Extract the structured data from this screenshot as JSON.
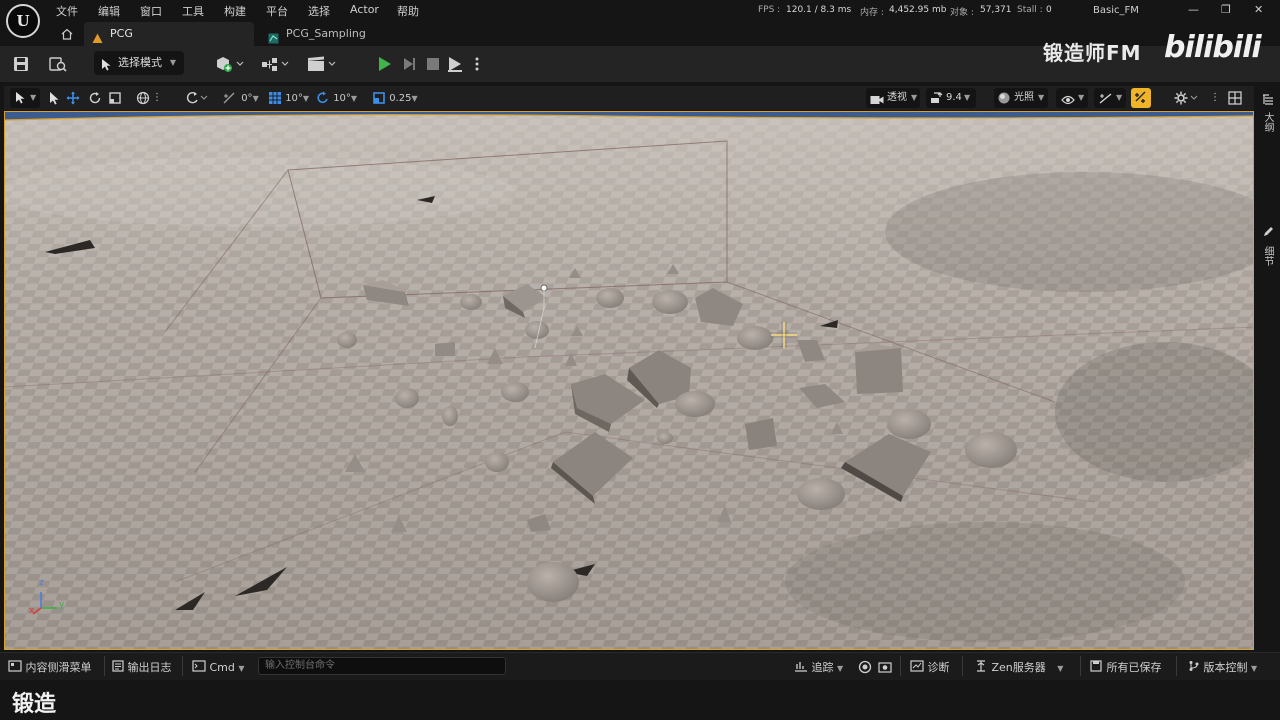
{
  "menu": [
    "文件",
    "编辑",
    "窗口",
    "工具",
    "构建",
    "平台",
    "选择",
    "Actor",
    "帮助"
  ],
  "stats": {
    "fps_label": "FPS :",
    "fps_value": "120.1 / 8.3 ms",
    "memory_label": "内存 :",
    "memory_value": "4,452.95 mb",
    "objects_label": "对象 :",
    "objects_value": "57,371",
    "stall_label": "Stall :",
    "stall_value": "0"
  },
  "project_name": "Basic_FM",
  "logo_text": "U",
  "tabs": [
    {
      "label": "PCG",
      "active": true
    },
    {
      "label": "PCG_Sampling",
      "active": false
    }
  ],
  "toolbar": {
    "mode_label": "选择模式"
  },
  "viewport_toolbar": {
    "rotation_snap": "0°",
    "grid_snap": "10°",
    "rotate_snap": "10°",
    "scale_snap": "0.25",
    "view_mode": "透视",
    "camera_speed": "9.4",
    "lighting_mode": "光照"
  },
  "viewport": {
    "axis_labels": {
      "z": "z",
      "x": "x",
      "y": "y"
    },
    "accent_color": "#d9a22e",
    "ground_color": "#a79e96",
    "shape_color": "#8f8781"
  },
  "side_panel": {
    "outliner": "大纲",
    "details": "细节"
  },
  "statusbar": {
    "content_drawer": "内容侧滑菜单",
    "output_log": "输出日志",
    "cmd_label": "Cmd",
    "cmd_placeholder": "输入控制台命令",
    "trace": "追踪",
    "diagnostics": "诊断",
    "zen_server": "Zen服务器",
    "all_saved": "所有已保存",
    "source_control": "版本控制"
  },
  "caption": "锻造",
  "watermark": {
    "text": "锻造师FM",
    "logo": "bilibili"
  },
  "icons": [
    "home-icon",
    "save-icon",
    "browse-icon",
    "add-actor-icon",
    "blueprint-icon",
    "cinematics-icon",
    "play-icon",
    "step-icon",
    "stop-icon",
    "eject-icon",
    "more-icon",
    "select-arrow-icon",
    "translate-icon",
    "rotate-icon",
    "scale-icon",
    "world-icon",
    "surface-snap-icon",
    "grid-icon",
    "rotation-snap-icon",
    "scale-snap-icon",
    "camera-icon",
    "speed-icon",
    "lit-sphere-icon",
    "eye-icon",
    "gear-icon",
    "layout-icon",
    "pencil-icon"
  ]
}
